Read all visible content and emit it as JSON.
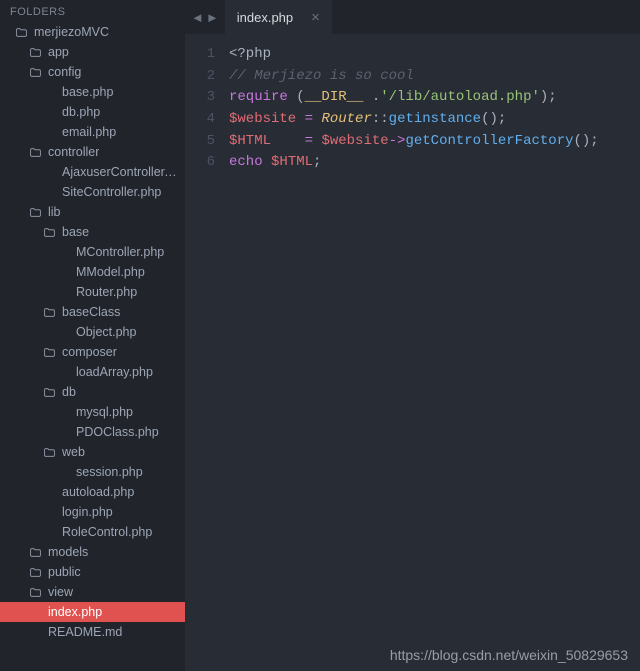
{
  "sidebar": {
    "header": "FOLDERS",
    "tree": [
      {
        "name": "merjiezoMVC",
        "type": "folder",
        "depth": 0
      },
      {
        "name": "app",
        "type": "folder",
        "depth": 1
      },
      {
        "name": "config",
        "type": "folder",
        "depth": 1
      },
      {
        "name": "base.php",
        "type": "file",
        "depth": 2
      },
      {
        "name": "db.php",
        "type": "file",
        "depth": 2
      },
      {
        "name": "email.php",
        "type": "file",
        "depth": 2
      },
      {
        "name": "controller",
        "type": "folder",
        "depth": 1
      },
      {
        "name": "AjaxuserController.php",
        "type": "file",
        "depth": 2
      },
      {
        "name": "SiteController.php",
        "type": "file",
        "depth": 2
      },
      {
        "name": "lib",
        "type": "folder",
        "depth": 1
      },
      {
        "name": "base",
        "type": "folder",
        "depth": 2
      },
      {
        "name": "MController.php",
        "type": "file",
        "depth": 3
      },
      {
        "name": "MModel.php",
        "type": "file",
        "depth": 3
      },
      {
        "name": "Router.php",
        "type": "file",
        "depth": 3
      },
      {
        "name": "baseClass",
        "type": "folder",
        "depth": 2
      },
      {
        "name": "Object.php",
        "type": "file",
        "depth": 3
      },
      {
        "name": "composer",
        "type": "folder",
        "depth": 2
      },
      {
        "name": "loadArray.php",
        "type": "file",
        "depth": 3
      },
      {
        "name": "db",
        "type": "folder",
        "depth": 2
      },
      {
        "name": "mysql.php",
        "type": "file",
        "depth": 3
      },
      {
        "name": "PDOClass.php",
        "type": "file",
        "depth": 3
      },
      {
        "name": "web",
        "type": "folder",
        "depth": 2
      },
      {
        "name": "session.php",
        "type": "file",
        "depth": 3
      },
      {
        "name": "autoload.php",
        "type": "file",
        "depth": 2
      },
      {
        "name": "login.php",
        "type": "file",
        "depth": 2
      },
      {
        "name": "RoleControl.php",
        "type": "file",
        "depth": 2
      },
      {
        "name": "models",
        "type": "folder",
        "depth": 1
      },
      {
        "name": "public",
        "type": "folder",
        "depth": 1
      },
      {
        "name": "view",
        "type": "folder",
        "depth": 1
      },
      {
        "name": "index.php",
        "type": "file",
        "depth": 1,
        "selected": true
      },
      {
        "name": "README.md",
        "type": "file",
        "depth": 1
      }
    ]
  },
  "tabs": {
    "active": "index.php"
  },
  "navArrows": {
    "left": "◄",
    "right": "►"
  },
  "code": {
    "lineCount": 6,
    "lines": [
      [
        {
          "t": "<?php",
          "c": "delim"
        }
      ],
      [
        {
          "t": "// Merjiezo is so cool",
          "c": "cmt"
        }
      ],
      [
        {
          "t": "require",
          "c": "kw"
        },
        {
          "t": " (",
          "c": "punc"
        },
        {
          "t": "__DIR__",
          "c": "const"
        },
        {
          "t": " .",
          "c": "punc"
        },
        {
          "t": "'/lib/autoload.php'",
          "c": "str"
        },
        {
          "t": ");",
          "c": "punc"
        }
      ],
      [
        {
          "t": "$website",
          "c": "var"
        },
        {
          "t": " ",
          "c": "punc"
        },
        {
          "t": "=",
          "c": "op"
        },
        {
          "t": " ",
          "c": "punc"
        },
        {
          "t": "Router",
          "c": "cls"
        },
        {
          "t": "::",
          "c": "punc"
        },
        {
          "t": "getinstance",
          "c": "fn"
        },
        {
          "t": "();",
          "c": "punc"
        }
      ],
      [
        {
          "t": "$HTML",
          "c": "var"
        },
        {
          "t": "    ",
          "c": "punc"
        },
        {
          "t": "=",
          "c": "op"
        },
        {
          "t": " ",
          "c": "punc"
        },
        {
          "t": "$website",
          "c": "var"
        },
        {
          "t": "->",
          "c": "op"
        },
        {
          "t": "getControllerFactory",
          "c": "fn"
        },
        {
          "t": "();",
          "c": "punc"
        }
      ],
      [
        {
          "t": "echo",
          "c": "kw"
        },
        {
          "t": " ",
          "c": "punc"
        },
        {
          "t": "$HTML",
          "c": "var"
        },
        {
          "t": ";",
          "c": "punc"
        }
      ]
    ]
  },
  "watermark": "https://blog.csdn.net/weixin_50829653"
}
